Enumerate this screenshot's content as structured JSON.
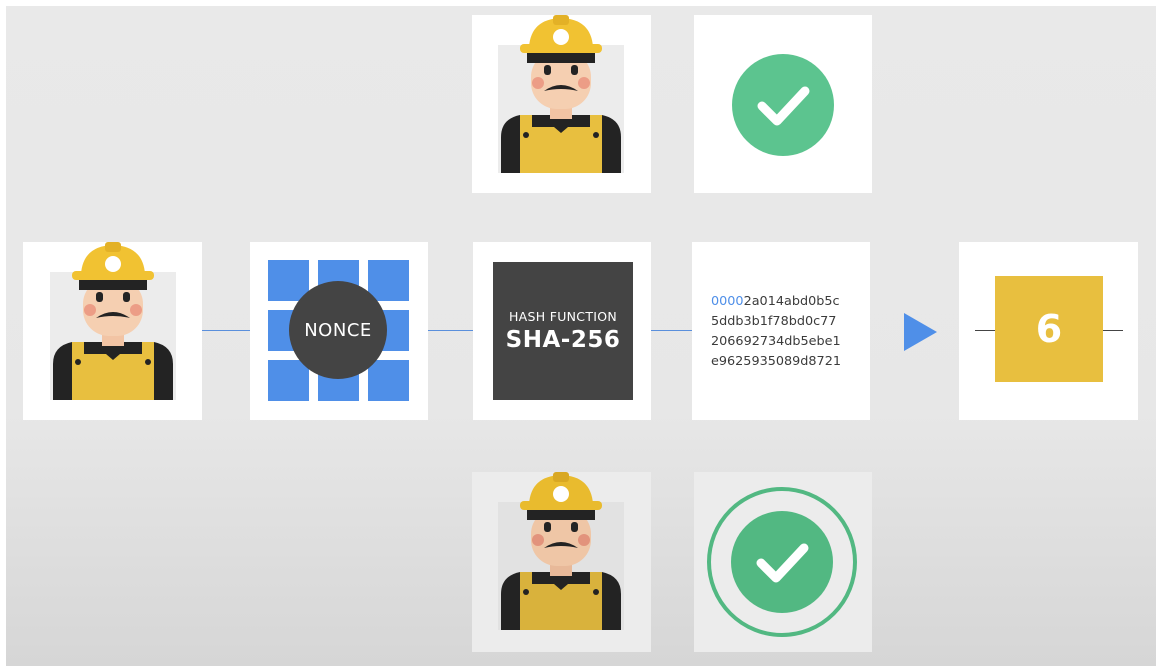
{
  "nonce": {
    "label": "NONCE"
  },
  "hash_function": {
    "subtitle": "HASH FUNCTION",
    "title": "SHA-256"
  },
  "hash_output": {
    "leading_zeros": "0000",
    "line1_rest": "2a014abd0b5c",
    "line2": "5ddb3b1f78bd0c77",
    "line3": "206692734db5ebe1",
    "line4": "e9625935089d8721"
  },
  "block": {
    "number": "6"
  },
  "colors": {
    "accent_blue": "#4f8fe8",
    "dark_box": "#444444",
    "block_yellow": "#e8bf3f",
    "check_green": "#5cc48f",
    "helmet_yellow": "#f1c232"
  },
  "icons": [
    "miner-icon",
    "check-icon",
    "arrow-right-icon"
  ]
}
